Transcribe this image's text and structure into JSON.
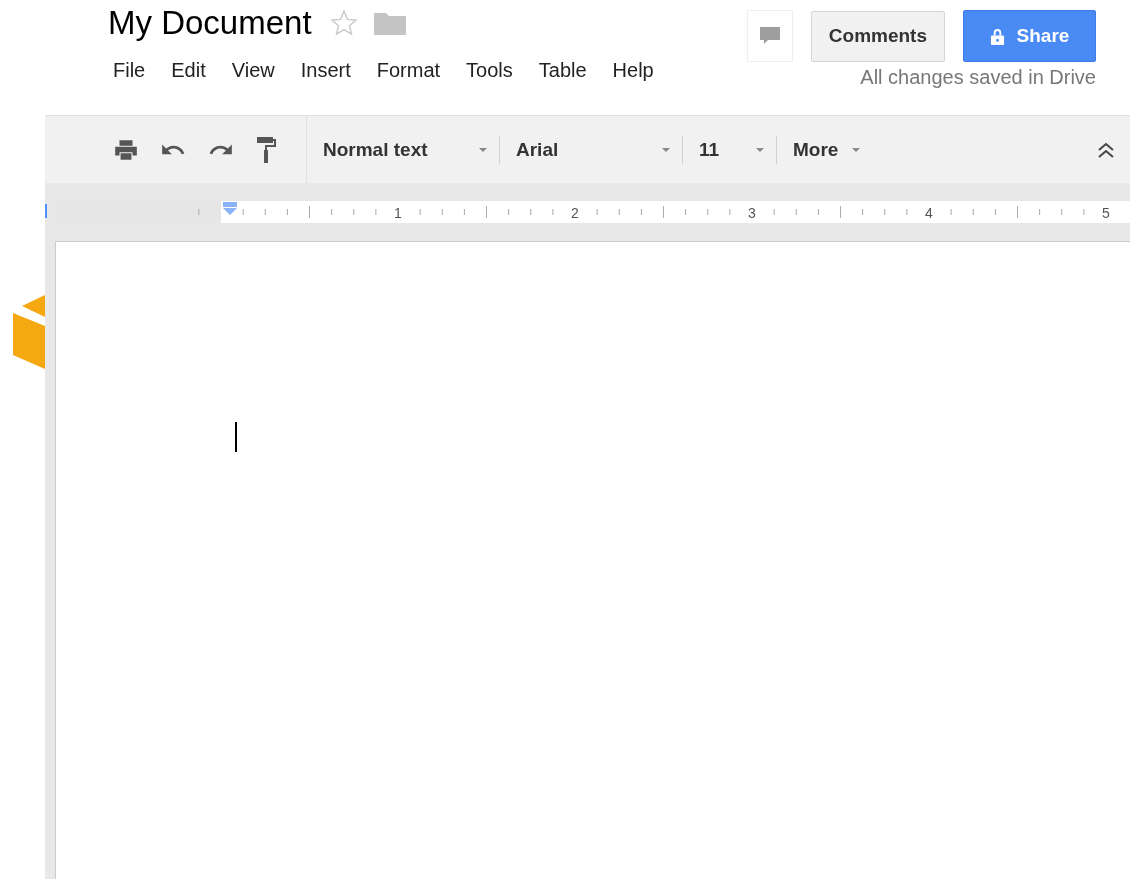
{
  "document": {
    "title": "My Document",
    "starred": false
  },
  "menu": [
    "File",
    "Edit",
    "View",
    "Insert",
    "Format",
    "Tools",
    "Table",
    "Help"
  ],
  "save_status": "All changes saved in Drive",
  "buttons": {
    "comments": "Comments",
    "share": "Share"
  },
  "toolbar": {
    "dropdowns": [
      {
        "label": "Normal text"
      },
      {
        "label": "Arial"
      },
      {
        "label": "11"
      },
      {
        "label": "More"
      }
    ]
  },
  "ruler": {
    "marks": [
      "1",
      "2",
      "3",
      "4",
      "5"
    ]
  }
}
